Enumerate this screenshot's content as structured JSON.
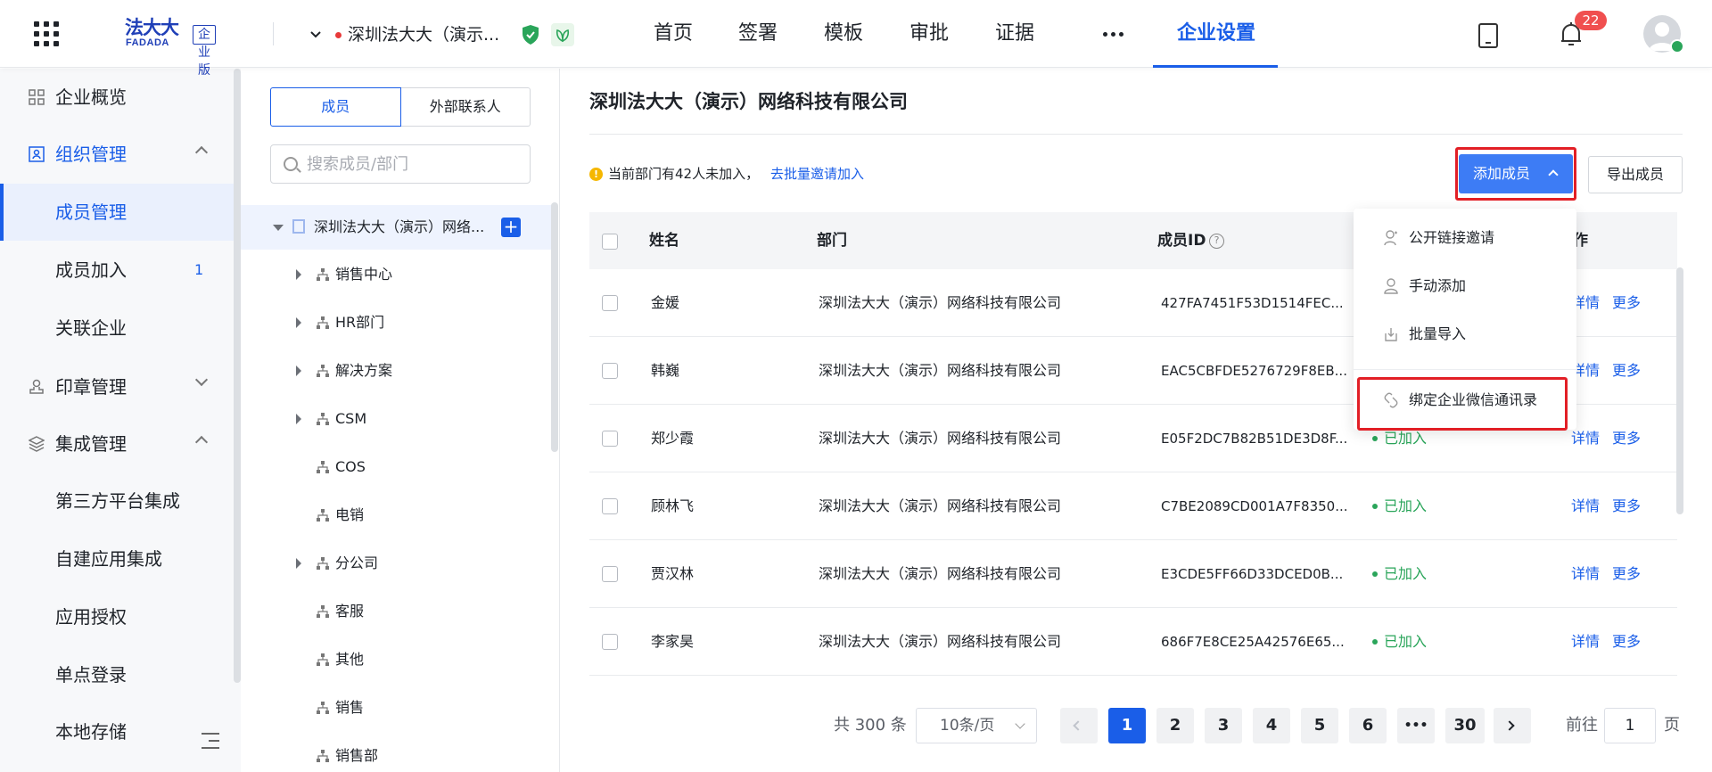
{
  "header": {
    "logo_text": "法大大",
    "logo_en": "FADADA",
    "edition": "企业版",
    "company_name": "深圳法大大（演示...",
    "nav": [
      "首页",
      "签署",
      "模板",
      "审批",
      "证据",
      "企业设置"
    ],
    "active_nav": "企业设置",
    "notification_count": "22",
    "icons": [
      "apps-grid-icon",
      "shield-check-icon",
      "leaf-icon",
      "phone-icon",
      "bell-icon"
    ]
  },
  "sidebar": {
    "items": [
      {
        "label": "企业概览",
        "icon": "overview-icon"
      },
      {
        "label": "组织管理",
        "icon": "org-icon",
        "expanded": true
      },
      {
        "label": "成员管理",
        "active": true
      },
      {
        "label": "成员加入",
        "count": "1"
      },
      {
        "label": "关联企业"
      },
      {
        "label": "印章管理",
        "icon": "seal-icon",
        "expanded": false
      },
      {
        "label": "集成管理",
        "icon": "layers-icon",
        "expanded": true
      },
      {
        "label": "第三方平台集成"
      },
      {
        "label": "自建应用集成"
      },
      {
        "label": "应用授权"
      },
      {
        "label": "单点登录"
      },
      {
        "label": "本地存储"
      }
    ]
  },
  "dept_panel": {
    "tabs": [
      "成员",
      "外部联系人"
    ],
    "active_tab": "成员",
    "search_placeholder": "搜索成员/部门",
    "root": "深圳法大大（演示）网络...",
    "departments": [
      {
        "name": "销售中心",
        "has_children": true
      },
      {
        "name": "HR部门",
        "has_children": true
      },
      {
        "name": "解决方案",
        "has_children": true
      },
      {
        "name": "CSM",
        "has_children": true
      },
      {
        "name": "COS",
        "has_children": false
      },
      {
        "name": "电销",
        "has_children": false
      },
      {
        "name": "分公司",
        "has_children": true
      },
      {
        "name": "客服",
        "has_children": false
      },
      {
        "name": "其他",
        "has_children": false
      },
      {
        "name": "销售",
        "has_children": false
      },
      {
        "name": "销售部",
        "has_children": false
      }
    ]
  },
  "main": {
    "title": "深圳法大大（演示）网络科技有限公司",
    "notice": "当前部门有42人未加入，",
    "notice_link": "去批量邀请加入",
    "add_member_label": "添加成员",
    "export_label": "导出成员",
    "columns": [
      "姓名",
      "部门",
      "成员ID",
      "操作"
    ],
    "header_partial": "作",
    "rows": [
      {
        "name": "金媛",
        "dept": "深圳法大大（演示）网络科技有限公司",
        "id": "427FA7451F53D1514FEC...",
        "status": ""
      },
      {
        "name": "韩巍",
        "dept": "深圳法大大（演示）网络科技有限公司",
        "id": "EAC5CBFDE5276729F8EB...",
        "status": ""
      },
      {
        "name": "郑少霞",
        "dept": "深圳法大大（演示）网络科技有限公司",
        "id": "E05F2DC7B82B51DE3D8F...",
        "status": "已加入"
      },
      {
        "name": "顾林飞",
        "dept": "深圳法大大（演示）网络科技有限公司",
        "id": "C7BE2089CD001A7F8350...",
        "status": "已加入"
      },
      {
        "name": "贾汉林",
        "dept": "深圳法大大（演示）网络科技有限公司",
        "id": "E3CDE5FF66D33DCED0B...",
        "status": "已加入"
      },
      {
        "name": "李家昊",
        "dept": "深圳法大大（演示）网络科技有限公司",
        "id": "686F7E8CE25A42576E65...",
        "status": "已加入"
      }
    ],
    "action_detail": "详情",
    "action_more": "更多"
  },
  "dropdown": {
    "items": [
      {
        "label": "公开链接邀请",
        "icon": "user-link-icon"
      },
      {
        "label": "手动添加",
        "icon": "user-icon"
      },
      {
        "label": "批量导入",
        "icon": "import-icon"
      },
      {
        "label": "绑定企业微信通讯录",
        "icon": "link-icon",
        "highlighted": true
      }
    ]
  },
  "pagination": {
    "total": "共 300 条",
    "page_size": "10条/页",
    "pages": [
      "1",
      "2",
      "3",
      "4",
      "5",
      "6",
      "•••",
      "30"
    ],
    "current": "1",
    "goto_label": "前往",
    "goto_value": "1",
    "goto_suffix": "页"
  },
  "colors": {
    "brand": "#1a5ee8",
    "highlight_box": "#e21f26",
    "status_joined": "#2aa55a"
  }
}
